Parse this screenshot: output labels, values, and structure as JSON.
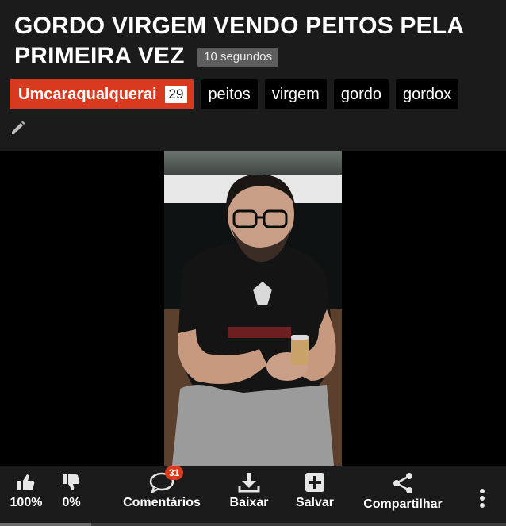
{
  "video": {
    "title": "GORDO VIRGEM VENDO PEITOS PELA PRIMEIRA VEZ",
    "duration": "10 segundos"
  },
  "channel": {
    "name": "Umcaraqualquerai",
    "count": "29",
    "color": "#d73a1e"
  },
  "tags": [
    "peitos",
    "virgem",
    "gordo",
    "gordox"
  ],
  "actions": {
    "like_percent": "100%",
    "dislike_percent": "0%",
    "comments_label": "Comentários",
    "comments_count": "31",
    "download_label": "Baixar",
    "save_label": "Salvar",
    "share_label": "Compartilhar"
  },
  "icons": {
    "edit": "pencil-icon",
    "like": "thumbs-up-icon",
    "dislike": "thumbs-down-icon",
    "comments": "speech-bubble-icon",
    "download": "download-icon",
    "save": "plus-square-icon",
    "share": "share-icon",
    "more": "vertical-dots-icon"
  }
}
